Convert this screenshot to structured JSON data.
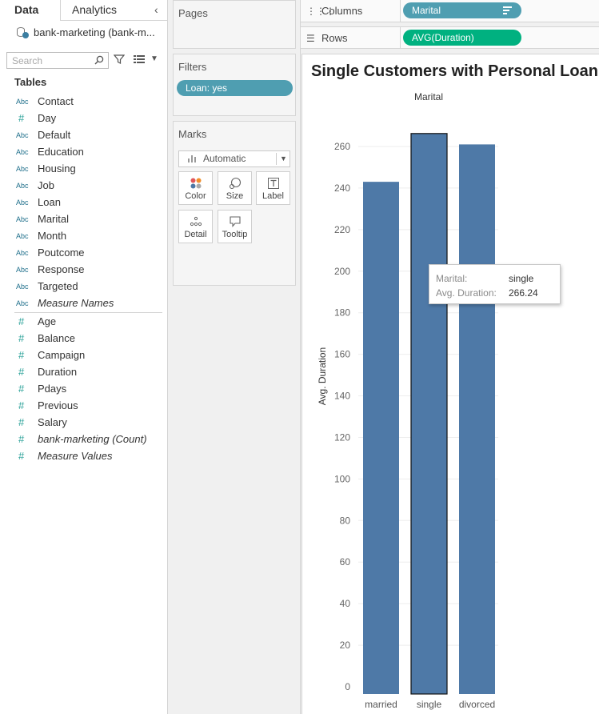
{
  "left_pane": {
    "tabs": [
      "Data",
      "Analytics"
    ],
    "datasource": "bank-marketing (bank-m...",
    "search_placeholder": "Search",
    "tables_header": "Tables",
    "dimensions": [
      {
        "type": "Abc",
        "name": "Contact"
      },
      {
        "type": "#",
        "name": "Day"
      },
      {
        "type": "Abc",
        "name": "Default"
      },
      {
        "type": "Abc",
        "name": "Education"
      },
      {
        "type": "Abc",
        "name": "Housing"
      },
      {
        "type": "Abc",
        "name": "Job"
      },
      {
        "type": "Abc",
        "name": "Loan"
      },
      {
        "type": "Abc",
        "name": "Marital"
      },
      {
        "type": "Abc",
        "name": "Month"
      },
      {
        "type": "Abc",
        "name": "Poutcome"
      },
      {
        "type": "Abc",
        "name": "Response"
      },
      {
        "type": "Abc",
        "name": "Targeted"
      },
      {
        "type": "Abc",
        "name": "Measure Names",
        "italic": true
      }
    ],
    "measures": [
      {
        "type": "#",
        "name": "Age"
      },
      {
        "type": "#",
        "name": "Balance"
      },
      {
        "type": "#",
        "name": "Campaign"
      },
      {
        "type": "#",
        "name": "Duration"
      },
      {
        "type": "#",
        "name": "Pdays"
      },
      {
        "type": "#",
        "name": "Previous"
      },
      {
        "type": "#",
        "name": "Salary"
      },
      {
        "type": "#",
        "name": "bank-marketing (Count)",
        "italic": true
      },
      {
        "type": "#",
        "name": "Measure Values",
        "italic": true
      }
    ]
  },
  "cards": {
    "pages_title": "Pages",
    "filters_title": "Filters",
    "filter_pill": "Loan: yes",
    "marks_title": "Marks",
    "marks_type": "Automatic",
    "mark_buttons": [
      "Color",
      "Size",
      "Label",
      "Detail",
      "Tooltip"
    ]
  },
  "shelves": {
    "columns_label": "Columns",
    "columns_pill": "Marital",
    "rows_label": "Rows",
    "rows_pill": "AVG(Duration)"
  },
  "colors": {
    "bar": "#4e79a7",
    "dimension_pill": "#4f9eb1",
    "measure_pill": "#00b180"
  },
  "viz": {
    "title": "Single Customers with Personal Loan"
  },
  "chart_data": {
    "type": "bar",
    "header": "Marital",
    "categories": [
      "married",
      "single",
      "divorced"
    ],
    "values": [
      243,
      266.24,
      261
    ],
    "ylabel": "Avg. Duration",
    "ylim": [
      0,
      260
    ],
    "yticks": [
      0,
      20,
      40,
      60,
      80,
      100,
      120,
      140,
      160,
      180,
      200,
      220,
      240,
      260
    ],
    "selected": "single",
    "grid": true
  },
  "tooltip": {
    "label1": "Marital:",
    "value1": "single",
    "label2": "Avg. Duration:",
    "value2": "266.24"
  }
}
